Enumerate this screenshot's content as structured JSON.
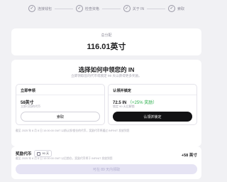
{
  "stepper": {
    "steps": [
      {
        "label": "连接钱包",
        "check": "✓"
      },
      {
        "label": "检查资格",
        "check": "✓"
      },
      {
        "label": "关于 IN",
        "check": "✓"
      },
      {
        "label": "索取",
        "check": "✓"
      }
    ]
  },
  "total": {
    "label": "总分配",
    "value": "116.01英寸"
  },
  "choose": {
    "title": "选择如何申领您的 IN",
    "subtitle": "立即领取您的代币或锁定 90 天以获得更多奖励。",
    "options": [
      {
        "heading": "立即申领",
        "amount": "58英寸",
        "bonus": "",
        "note": "立即可用的代币",
        "button": "索取"
      },
      {
        "heading": "认领并锁定",
        "amount": "72.5 IN",
        "bonus": "（+25% 奖励）",
        "note": "锁定 90 天后解锁",
        "button": "认领并锁定"
      }
    ],
    "footnote": "截至 2025 年 8 月 8 日 10:00:00 GMT 以前认领/锁仓的代币，奖励代币将通过 INFINIT 发放到您"
  },
  "reward": {
    "title": "奖励代币",
    "badge": "90 天",
    "note": "截至 2025 年 8 月 8 日 10:00:00 GMT 以后锁仓，奖励代币将于 INFINIT 发放到您",
    "amount": "+58 英寸",
    "claim_button": "可在 89 天内领取"
  }
}
